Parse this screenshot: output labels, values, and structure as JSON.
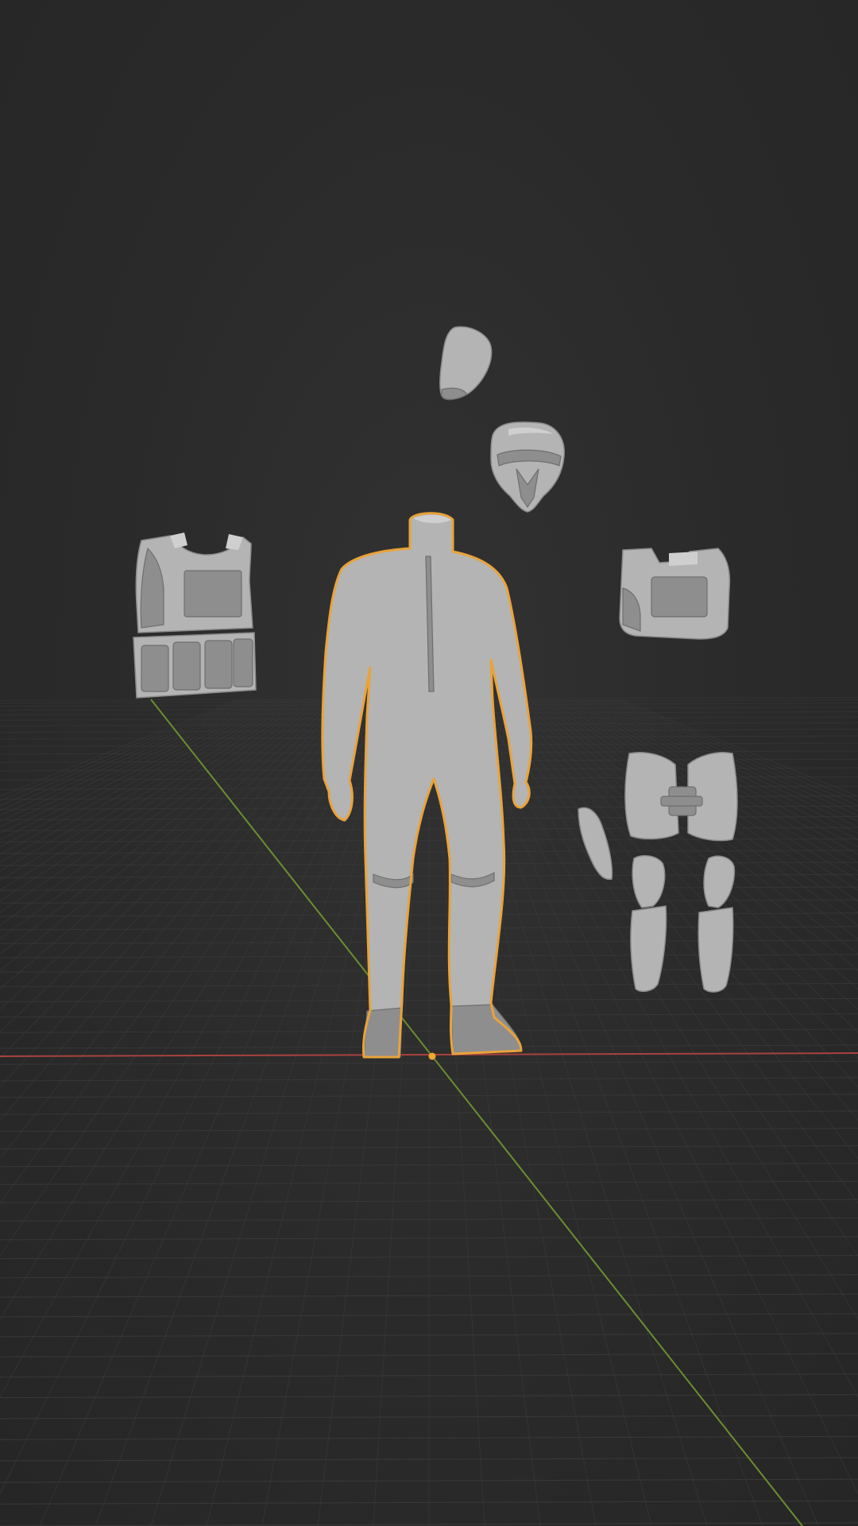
{
  "app": {
    "name": "3D viewport",
    "view": "perspective",
    "mode": "object",
    "shading": "solid"
  },
  "colors": {
    "background": "#2b2b2b",
    "grid_line": "#3a3a3a",
    "axis_x": "#a8423f",
    "axis_y": "#6b8f2e",
    "selection_outline": "#e9a33a",
    "origin_dot": "#f0a830",
    "mesh": "#b4b4b4"
  },
  "scene": {
    "objects": [
      {
        "name": "visor",
        "selected": false
      },
      {
        "name": "helmet",
        "selected": false
      },
      {
        "name": "tactical-vest",
        "selected": false
      },
      {
        "name": "flight-suit-body",
        "selected": true
      },
      {
        "name": "chest-plate",
        "selected": false
      },
      {
        "name": "thigh-armor",
        "selected": false
      },
      {
        "name": "forearm-plate",
        "selected": false
      },
      {
        "name": "shin-guard-left",
        "selected": false
      },
      {
        "name": "shin-guard-right",
        "selected": false
      }
    ]
  }
}
